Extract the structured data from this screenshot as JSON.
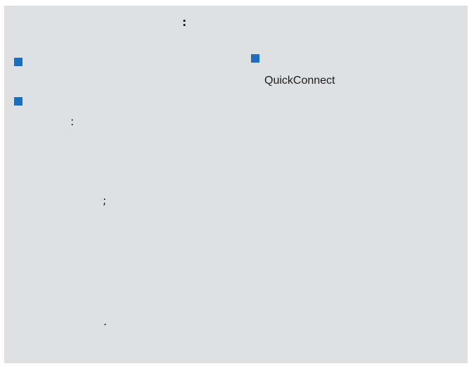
{
  "header": {
    "punct": ":"
  },
  "left_column": {
    "items": [
      {
        "icon": "blue-square-bullet-icon"
      },
      {
        "icon": "blue-square-bullet-icon"
      }
    ],
    "fragments": [
      ":",
      ";",
      "."
    ]
  },
  "right_column": {
    "items": [
      {
        "icon": "blue-square-bullet-icon",
        "label": "QuickConnect"
      }
    ]
  },
  "colors": {
    "background": "#dfe0e2",
    "bullet": "#1a6fc1",
    "text": "#1c1c1c"
  }
}
